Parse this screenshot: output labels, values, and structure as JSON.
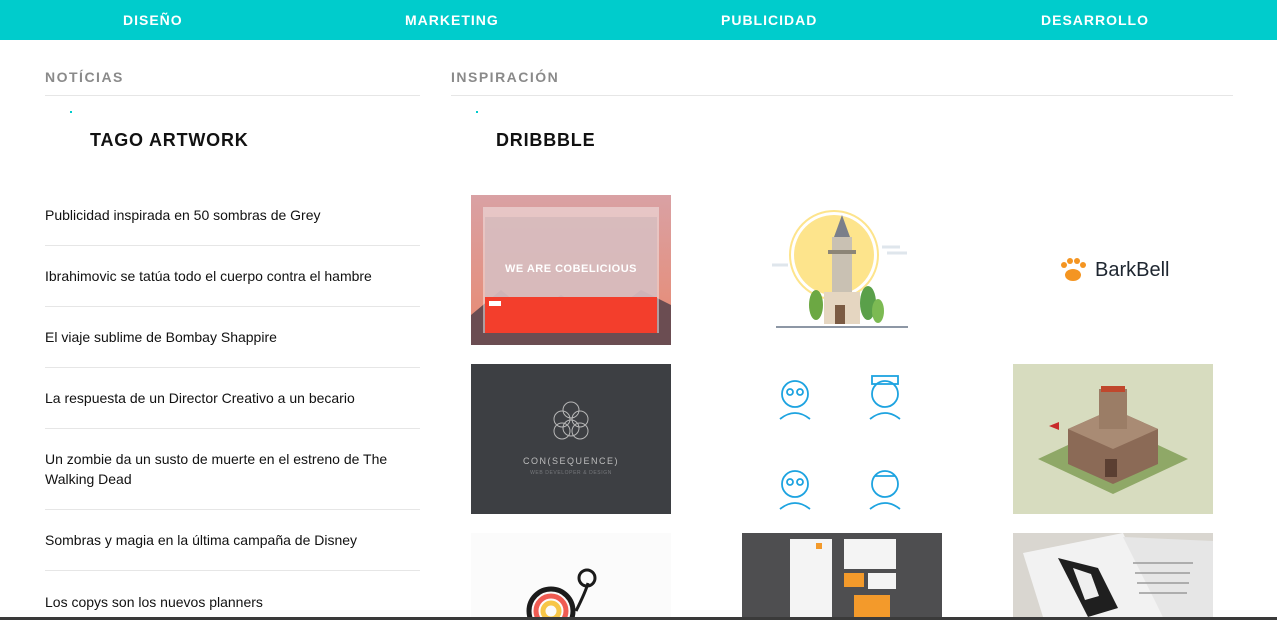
{
  "nav": [
    "DISEÑO",
    "MARKETING",
    "PUBLICIDAD",
    "DESARROLLO"
  ],
  "news": {
    "header": "NOTÍCIAS",
    "source": "TAGO ARTWORK",
    "items": [
      "Publicidad inspirada en 50 sombras de Grey",
      "Ibrahimovic se tatúa todo el cuerpo contra el hambre",
      "El viaje sublime de Bombay Shappire",
      "La respuesta de un Director Creativo a un becario",
      "Un zombie da un susto de muerte en el estreno de The Walking Dead",
      "Sombras y magia en la última campaña de Disney",
      "Los copys son los nuevos planners"
    ]
  },
  "inspiration": {
    "header": "INSPIRACIÓN",
    "source": "DRIBBBLE",
    "shot_texts": {
      "cobelicious": "WE ARE COBELICIOUS",
      "barkbell": "BarkBell",
      "consequence": "CON(SEQUENCE)",
      "consequence_sub": "WEB DEVELOPER & DESIGN"
    }
  },
  "colors": {
    "accent": "#00cccc"
  }
}
